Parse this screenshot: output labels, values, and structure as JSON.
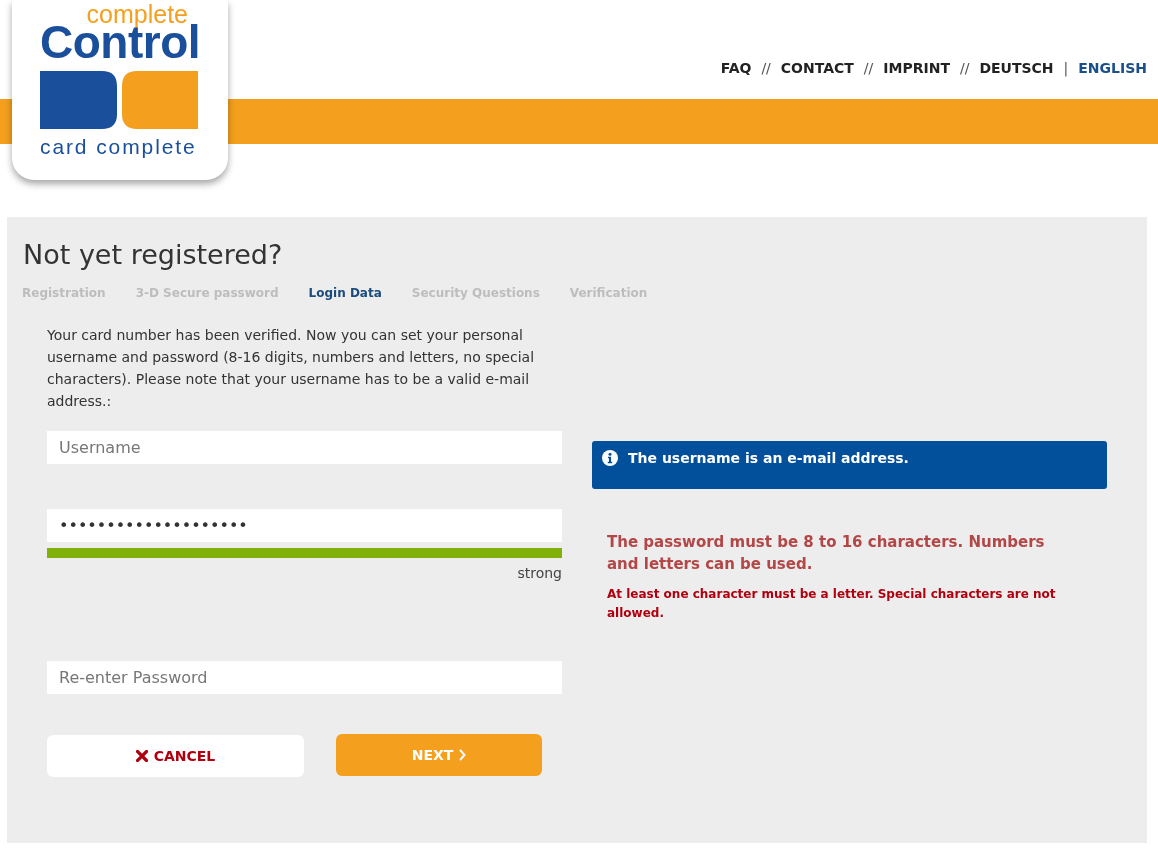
{
  "header": {
    "logo": {
      "tagline": "complete",
      "wordmark": "Control",
      "brand": "card complete"
    },
    "nav": [
      {
        "label": "FAQ",
        "selected": false,
        "separator": "//"
      },
      {
        "label": "CONTACT",
        "selected": false,
        "separator": "//"
      },
      {
        "label": "IMPRINT",
        "selected": false,
        "separator": "//"
      },
      {
        "label": "DEUTSCH",
        "selected": false,
        "separator": "|"
      },
      {
        "label": "ENGLISH",
        "selected": true
      }
    ]
  },
  "panel": {
    "title": "Not yet registered?",
    "steps": [
      {
        "label": "Registration",
        "selected": false
      },
      {
        "label": "3-D Secure password",
        "selected": false
      },
      {
        "label": "Login Data",
        "selected": true
      },
      {
        "label": "Security Questions",
        "selected": false
      },
      {
        "label": "Verification",
        "selected": false
      }
    ],
    "intro": "Your card number has been verified. Now you can set your personal username and password (8-16 digits, numbers and letters, no special characters). Please note that your username has to be a valid e-mail address.:",
    "form": {
      "username": {
        "placeholder": "Username"
      },
      "password": {
        "value": "••••••••••••••••••••",
        "strength": {
          "level": 1,
          "label": "strong"
        }
      },
      "confirm": {
        "placeholder": "Re-enter Password"
      }
    },
    "buttons": [
      {
        "kind": "cancel",
        "label": "CANCEL"
      },
      {
        "kind": "next",
        "label": "NEXT"
      }
    ],
    "info": "The username is an e-mail address.",
    "hints": [
      {
        "kind": "rule",
        "text": "The password must be 8 to 16 characters. Numbers and letters can be used."
      },
      {
        "kind": "error",
        "text": "At least one character must be a letter. Special characters are not allowed."
      }
    ]
  }
}
